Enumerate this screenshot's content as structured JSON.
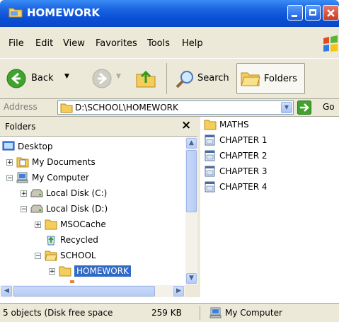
{
  "window": {
    "title": "HOMEWORK"
  },
  "menu": [
    "File",
    "Edit",
    "View",
    "Favorites",
    "Tools",
    "Help"
  ],
  "toolbar": {
    "back_label": "Back",
    "search_label": "Search",
    "folders_label": "Folders"
  },
  "address": {
    "label": "Address",
    "value": "D:\\SCHOOL\\HOMEWORK",
    "go_label": "Go"
  },
  "folders_pane": {
    "title": "Folders",
    "close_symbol": "×",
    "tree": [
      {
        "label": "Desktop",
        "icon": "desktop-icon"
      },
      {
        "label": "My Documents",
        "icon": "my-documents-icon",
        "expander": "+"
      },
      {
        "label": "My Computer",
        "icon": "my-computer-icon",
        "expander": "−"
      },
      {
        "label": "Local Disk (C:)",
        "icon": "drive-icon",
        "expander": "+"
      },
      {
        "label": "Local Disk (D:)",
        "icon": "drive-icon",
        "expander": "−"
      },
      {
        "label": "MSOCache",
        "icon": "folder-icon",
        "expander": "+"
      },
      {
        "label": "Recycled",
        "icon": "recycle-bin-icon"
      },
      {
        "label": "SCHOOL",
        "icon": "folder-open-icon",
        "expander": "−"
      },
      {
        "label": "HOMEWORK",
        "icon": "folder-icon",
        "expander": "+",
        "selected": true
      }
    ]
  },
  "files": [
    {
      "name": "MATHS",
      "icon": "folder-icon"
    },
    {
      "name": "CHAPTER 1",
      "icon": "document-icon"
    },
    {
      "name": "CHAPTER 2",
      "icon": "document-icon"
    },
    {
      "name": "CHAPTER 3",
      "icon": "document-icon"
    },
    {
      "name": "CHAPTER 4",
      "icon": "document-icon"
    }
  ],
  "status": {
    "left": "5 objects (Disk free space",
    "size": "259 KB",
    "location": "My Computer"
  },
  "colors": {
    "titlebar": "#0a4fd6",
    "selection": "#316ac5",
    "chrome": "#ece9d8"
  }
}
